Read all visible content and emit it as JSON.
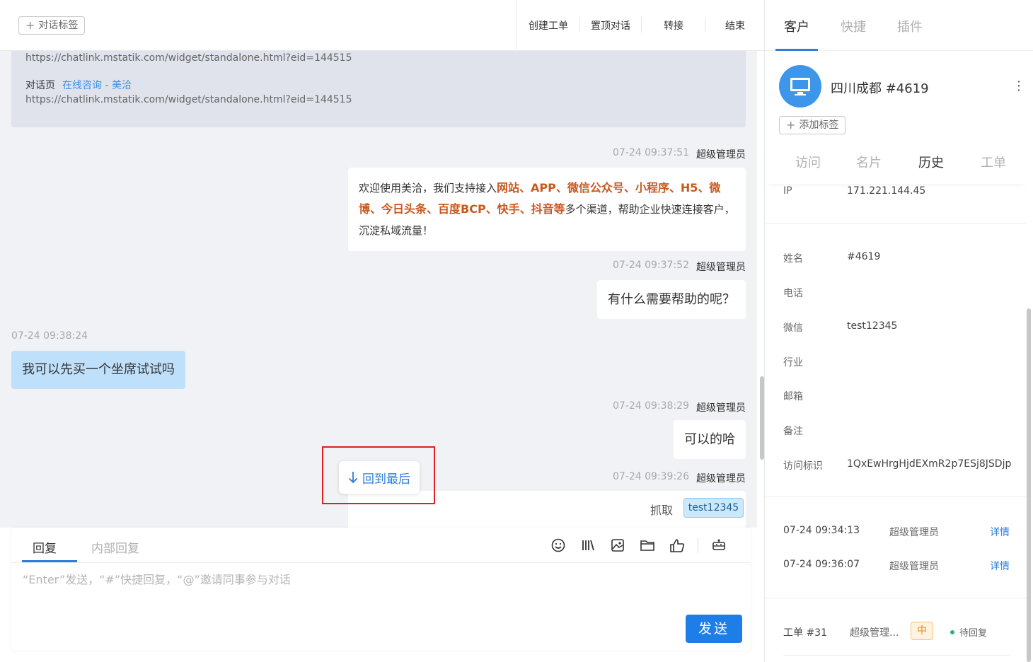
{
  "header": {
    "tag_button_label": "对话标签",
    "actions": [
      "创建工单",
      "置顶对话",
      "转接",
      "结束"
    ]
  },
  "info_box": {
    "url_top": "https://chatlink.mstatik.com/widget/standalone.html?eid=144515",
    "page_label": "对话页",
    "page_link": "在线咨询 - 美洽",
    "url_bottom": "https://chatlink.mstatik.com/widget/standalone.html?eid=144515"
  },
  "messages": [
    {
      "time": "07-24 09:37:51",
      "sender": "超级管理员",
      "text_a": "欢迎使用美洽，我们支持接入",
      "hl_a": "网站、APP、微信公众号、小程序、H5、微博、今日头条、百度BCP、快手、抖音等",
      "text_b": "多个渠道，帮助企业快速连接客户，沉淀私域流量！"
    },
    {
      "time": "07-24 09:37:52",
      "sender": "超级管理员",
      "text": "有什么需要帮助的呢？"
    },
    {
      "time": "07-24 09:38:24",
      "text": "我可以先买一个坐席试试吗"
    },
    {
      "time": "07-24 09:38:29",
      "sender": "超级管理员",
      "text": "可以的哈"
    },
    {
      "time": "07-24 09:39:26",
      "sender": "超级管理员"
    }
  ],
  "jump_to_last_label": "回到最后",
  "grab": {
    "label": "抓取",
    "tag": "test12345"
  },
  "composer": {
    "tabs": [
      "回复",
      "内部回复"
    ],
    "placeholder": "“Enter”发送，“#”快捷回复，“@”邀请同事参与对话",
    "send_label": "发送",
    "tool_icons": [
      "emoji-icon",
      "quick-phrase-icon",
      "image-icon",
      "folder-icon",
      "thumbs-up-icon",
      "robot-icon"
    ]
  },
  "right_panel": {
    "tabs": [
      "客户",
      "快捷",
      "插件"
    ],
    "customer_name": "四川成都 #4619",
    "add_tag_label": "添加标签",
    "sub_tabs": [
      "访问",
      "名片",
      "历史",
      "工单"
    ],
    "ip_label": "IP",
    "ip_value": "171.221.144.45",
    "fields": [
      {
        "label": "姓名",
        "value": "#4619"
      },
      {
        "label": "电话",
        "value": ""
      },
      {
        "label": "微信",
        "value": "test12345"
      },
      {
        "label": "行业",
        "value": ""
      },
      {
        "label": "邮箱",
        "value": ""
      },
      {
        "label": "备注",
        "value": ""
      },
      {
        "label": "访问标识",
        "value": "1QxEwHrgHjdEXmR2p7ESj8JSDjp"
      }
    ],
    "history": [
      {
        "time": "07-24 09:34:13",
        "agent": "超级管理员",
        "link": "详情"
      },
      {
        "time": "07-24 09:36:07",
        "agent": "超级管理员",
        "link": "详情"
      }
    ],
    "ticket": {
      "number": "工单 #31",
      "agent": "超级管理...",
      "priority": "中",
      "status": "待回复"
    }
  },
  "colors": {
    "accent": "#1e7ee8",
    "highlight": "#c8581e",
    "customer_bubble": "#bfe0fb"
  }
}
